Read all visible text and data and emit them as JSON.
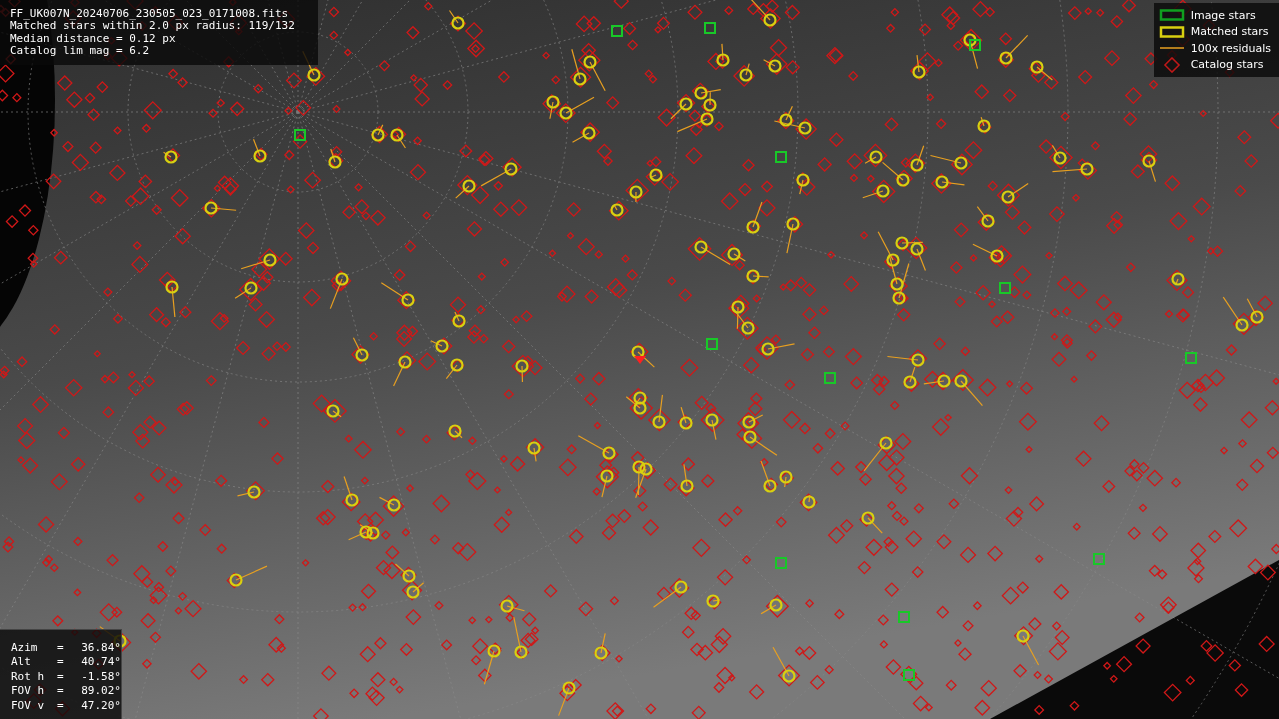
{
  "info_panel": {
    "lines": [
      "FF_UK007N_20240706_230505_023_0171008.fits",
      "Matched stars within 2.0 px radius: 119/132",
      "Median distance = 0.12 px",
      "Catalog lim mag = 6.2"
    ]
  },
  "legend": {
    "items": [
      {
        "kind": "image",
        "label": "Image stars"
      },
      {
        "kind": "matched",
        "label": "Matched stars"
      },
      {
        "kind": "residual",
        "label": "100x residuals"
      },
      {
        "kind": "catalog",
        "label": "Catalog stars"
      }
    ]
  },
  "pointing_panel": {
    "rows": [
      {
        "label": "Azim",
        "equals": "=",
        "value": "36.84°"
      },
      {
        "label": "Alt",
        "equals": "=",
        "value": "40.74°"
      },
      {
        "label": "Rot h",
        "equals": "=",
        "value": "-1.58°"
      },
      {
        "label": "FOV h",
        "equals": "=",
        "value": "89.02°"
      },
      {
        "label": "FOV v",
        "equals": "=",
        "value": "47.20°"
      }
    ]
  }
}
